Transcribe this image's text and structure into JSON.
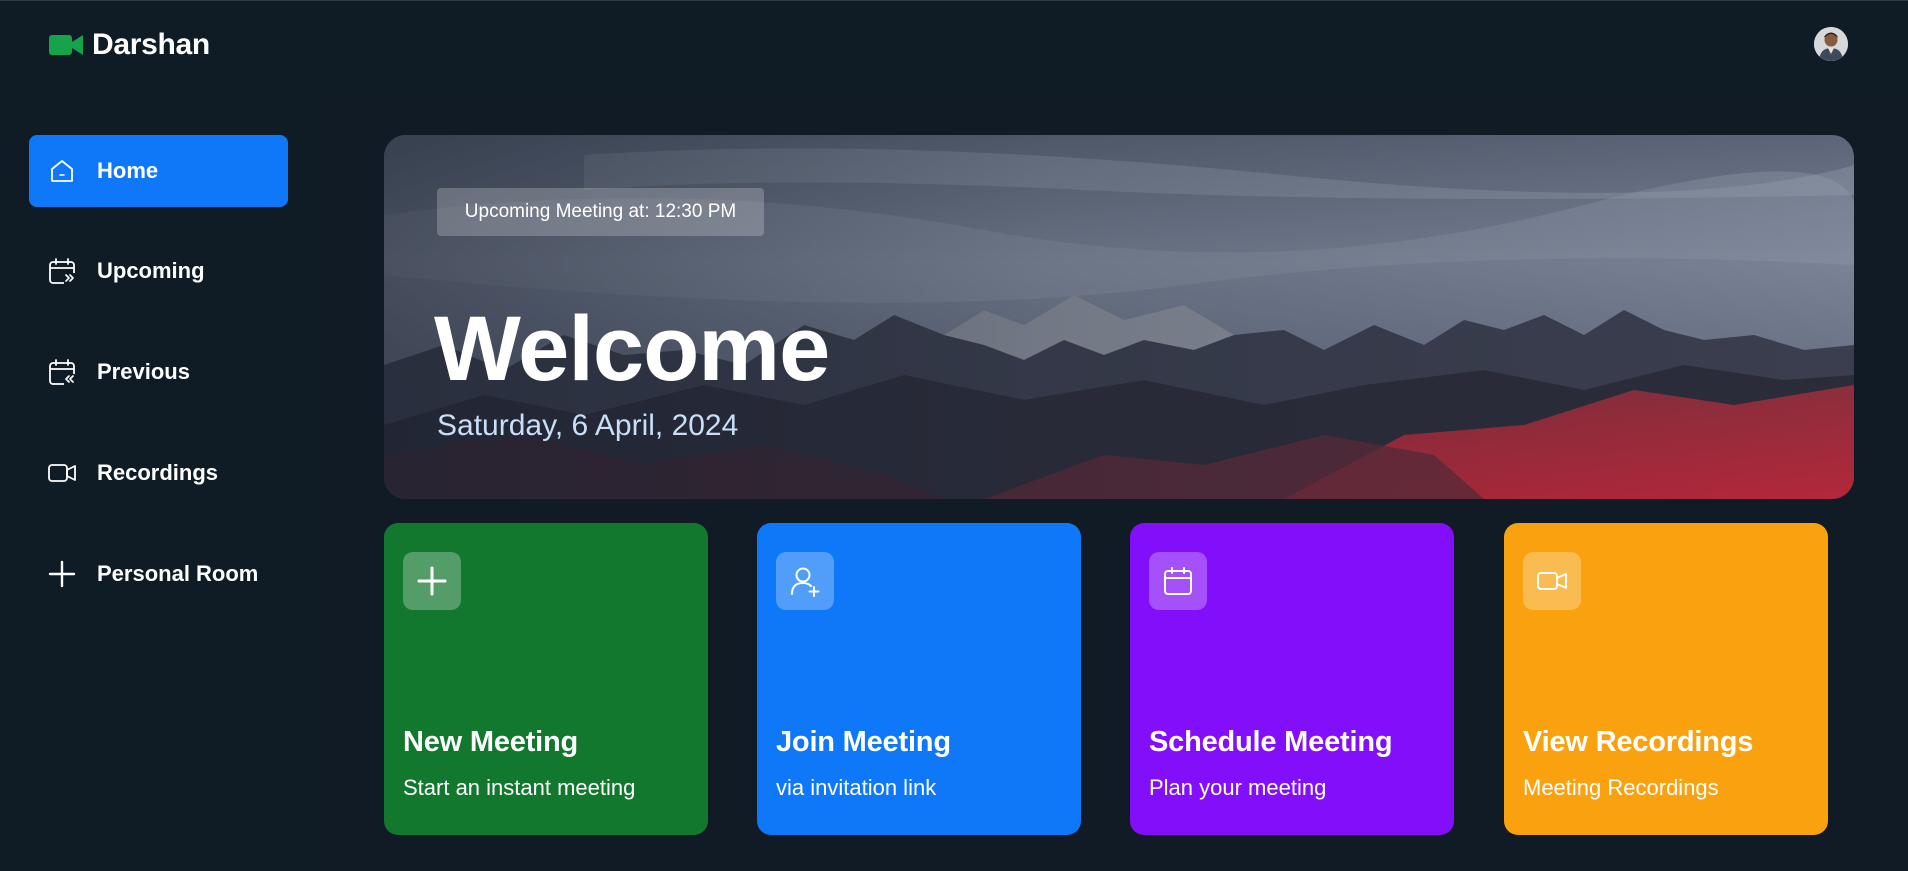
{
  "header": {
    "brand_name": "Darshan",
    "brand_icon": "video-camera-icon",
    "avatar": "user-avatar"
  },
  "colors": {
    "background": "#0d1b25",
    "accent": "#0e78f9",
    "green": "#12782e",
    "blue": "#0e78f9",
    "purple": "#830ef9",
    "orange": "#f9a10e"
  },
  "sidebar": {
    "items": [
      {
        "label": "Home",
        "icon": "home-icon",
        "active": true
      },
      {
        "label": "Upcoming",
        "icon": "calendar-forward-icon",
        "active": false
      },
      {
        "label": "Previous",
        "icon": "calendar-back-icon",
        "active": false
      },
      {
        "label": "Recordings",
        "icon": "video-icon",
        "active": false
      },
      {
        "label": "Personal Room",
        "icon": "plus-icon",
        "active": false
      }
    ]
  },
  "hero": {
    "upcoming": "Upcoming Meeting at: 12:30 PM",
    "title": "Welcome",
    "date": "Saturday, 6 April, 2024"
  },
  "cards": [
    {
      "title": "New Meeting",
      "subtitle": "Start an instant meeting",
      "icon": "plus-icon"
    },
    {
      "title": "Join Meeting",
      "subtitle": "via invitation link",
      "icon": "user-add-icon"
    },
    {
      "title": "Schedule Meeting",
      "subtitle": "Plan your meeting",
      "icon": "calendar-icon"
    },
    {
      "title": "View Recordings",
      "subtitle": "Meeting Recordings",
      "icon": "video-icon"
    }
  ]
}
